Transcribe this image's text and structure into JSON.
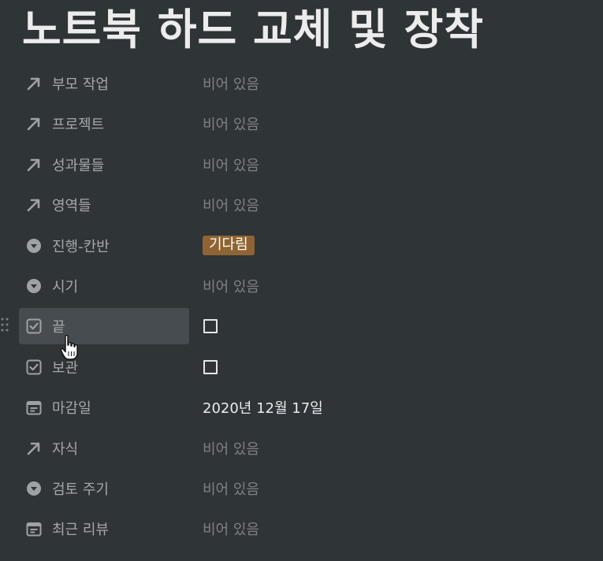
{
  "page": {
    "title": "노트북 하드 교체 및 장착"
  },
  "colors": {
    "background": "#2f3437",
    "hover_row": "#474c50",
    "tag_background": "#8f6433",
    "tag_text": "#ffffff"
  },
  "properties": [
    {
      "name": "부모 작업",
      "icon": "relation-arrow-icon",
      "type": "empty",
      "value": "비어 있음"
    },
    {
      "name": "프로젝트",
      "icon": "relation-arrow-icon",
      "type": "empty",
      "value": "비어 있음"
    },
    {
      "name": "성과물들",
      "icon": "relation-arrow-icon",
      "type": "empty",
      "value": "비어 있음"
    },
    {
      "name": "영역들",
      "icon": "relation-arrow-icon",
      "type": "empty",
      "value": "비어 있음"
    },
    {
      "name": "진행-칸반",
      "icon": "select-chevron-icon",
      "type": "tag",
      "value": "기다림"
    },
    {
      "name": "시기",
      "icon": "select-chevron-icon",
      "type": "empty",
      "value": "비어 있음"
    },
    {
      "name": "끝",
      "icon": "checkbox-property-icon",
      "type": "checkbox",
      "value": false,
      "hovered": true
    },
    {
      "name": "보관",
      "icon": "checkbox-property-icon",
      "type": "checkbox",
      "value": false
    },
    {
      "name": "마감일",
      "icon": "calendar-icon",
      "type": "date",
      "value": "2020년 12월 17일"
    },
    {
      "name": "자식",
      "icon": "relation-arrow-icon",
      "type": "empty",
      "value": "비어 있음"
    },
    {
      "name": "검토 주기",
      "icon": "select-chevron-icon",
      "type": "empty",
      "value": "비어 있음"
    },
    {
      "name": "최근 리뷰",
      "icon": "calendar-icon",
      "type": "empty",
      "value": "비어 있음"
    }
  ]
}
